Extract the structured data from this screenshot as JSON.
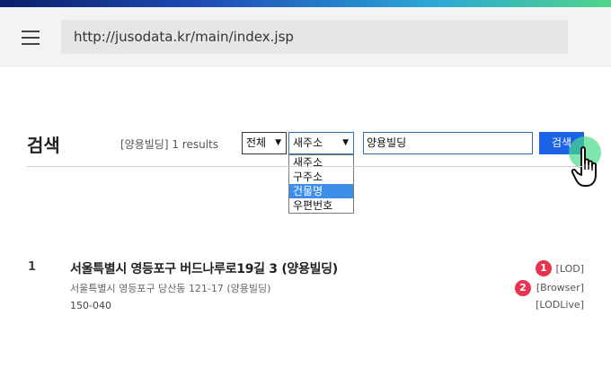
{
  "browser": {
    "url": "http://jusodata.kr/main/index.jsp",
    "menu_icon": "hamburger-menu-icon"
  },
  "search": {
    "title": "검색",
    "result_count": "[양용빌딩] 1 results",
    "scope_select": {
      "value": "전체"
    },
    "type_select": {
      "value": "새주소",
      "options": [
        "새주소",
        "구주소",
        "건물명",
        "우편번호"
      ],
      "highlighted_index": 2
    },
    "query": "양용빌딩",
    "button_label": "검색"
  },
  "results": [
    {
      "number": "1",
      "title": "서울특별시 영등포구 버드나루로19길 3 (양용빌딩)",
      "sub_address": "서울특별시 영등포구 당산동 121-17 (양용빌딩)",
      "zip": "150-040",
      "links": [
        "[LOD]",
        "[Browser]",
        "[LODLive]"
      ]
    }
  ],
  "annotations": [
    "1",
    "2"
  ],
  "colors": {
    "search_button": "#1d63e8",
    "badge": "#e8334f",
    "option_highlight": "#3d8ee8",
    "click_pulse": "#4adc8c"
  }
}
